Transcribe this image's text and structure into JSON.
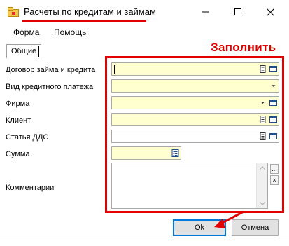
{
  "window": {
    "title": "Расчеты по кредитам и займам",
    "minimize_icon": "minimize-icon",
    "maximize_icon": "maximize-icon",
    "close_icon": "close-icon"
  },
  "menu": {
    "items": [
      "Форма",
      "Помощь"
    ]
  },
  "tabs": [
    {
      "label": "Общие",
      "active": true
    }
  ],
  "annotation": {
    "text": "Заполнить",
    "color": "#e00000"
  },
  "form": {
    "fields": [
      {
        "label": "Договор займа и кредита",
        "value": "",
        "buttons": [
          "doc-icon",
          "list-icon"
        ]
      },
      {
        "label": "Вид кредитного платежа",
        "value": "",
        "buttons": [
          "dropdown-arrow-icon"
        ]
      },
      {
        "label": "Фирма",
        "value": "",
        "buttons": [
          "dropdown-arrow-icon",
          "list-icon"
        ]
      },
      {
        "label": "Клиент",
        "value": "",
        "buttons": [
          "doc-icon",
          "list-icon"
        ]
      },
      {
        "label": "Статья ДДС",
        "value": "",
        "buttons": [
          "doc-icon",
          "list-icon"
        ]
      },
      {
        "label": "Сумма",
        "value": "",
        "buttons": [
          "calculator-icon"
        ]
      },
      {
        "label": "Комментарии",
        "value": "",
        "buttons": [
          "ellipsis-icon",
          "clear-icon"
        ]
      }
    ],
    "ellipsis_button_label": "...",
    "clear_button_label": "×"
  },
  "buttons": {
    "ok_label": "Ok",
    "cancel_label": "Отмена"
  },
  "colors": {
    "required_field_bg": "#ffffd0",
    "highlight": "#e00000",
    "default_button_border": "#0078d7"
  }
}
